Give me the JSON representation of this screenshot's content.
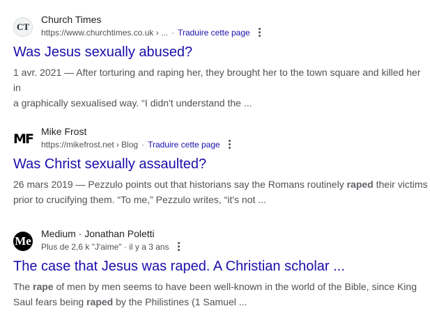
{
  "results": [
    {
      "favicon_text": "CT",
      "site_name": "Church Times",
      "url": "https://www.churchtimes.co.uk › ...",
      "translate": "Traduire cette page",
      "title": "Was Jesus sexually abused?",
      "snippet_line1": "1 avr. 2021 — After torturing and raping her, they brought her to the town square and killed her in",
      "snippet_line2": "a graphically sexualised way. “I didn't understand the ..."
    },
    {
      "favicon_text": "MF",
      "site_name": "Mike Frost",
      "url": "https://mikefrost.net",
      "crumb": "› Blog",
      "translate": "Traduire cette page",
      "title": "Was Christ sexually assaulted?",
      "snippet_line1_a": "26 mars 2019 — Pezzulo points out that historians say the Romans routinely ",
      "snippet_line1_bold": "raped",
      "snippet_line1_b": " their victims",
      "snippet_line2": "prior to crucifying them. “To me,” Pezzulo writes, “it's not ..."
    },
    {
      "favicon_text": "Me",
      "site_name": "Medium",
      "site_sub": " · Jonathan Poletti",
      "meta": "Plus de 2,6 k \"J'aime\" · il y a 3 ans",
      "title": "The case that Jesus was raped. A Christian scholar ...",
      "snippet_line1_a": "The ",
      "snippet_line1_bold1": "rape",
      "snippet_line1_b": " of men by men seems to have been well-known in the world of the Bible, since King",
      "snippet_line2_a": "Saul fears being ",
      "snippet_line2_bold": "raped",
      "snippet_line2_b": " by the Philistines (1 Samuel ..."
    }
  ]
}
